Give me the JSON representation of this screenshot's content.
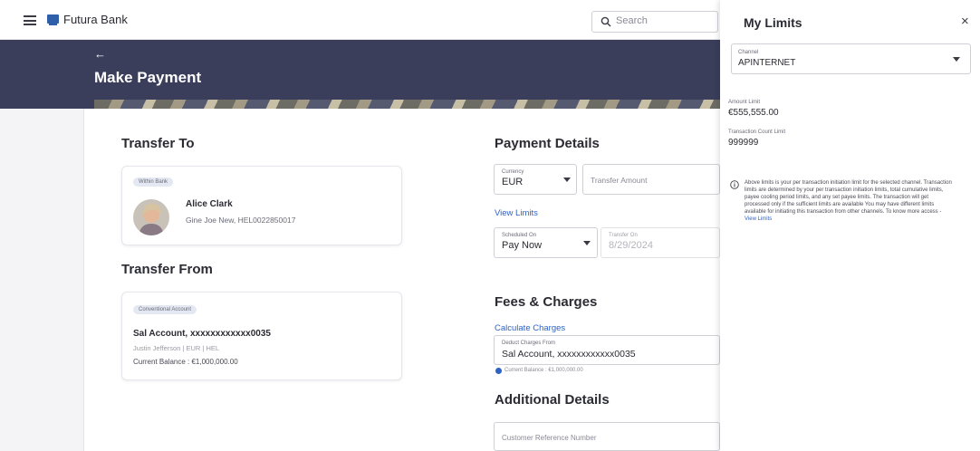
{
  "topbar": {
    "brand": "Futura Bank",
    "search_placeholder": "Search",
    "icons": [
      "hamburger-icon",
      "bank-logo-icon",
      "search-icon"
    ]
  },
  "page": {
    "back_symbol": "←",
    "title": "Make Payment"
  },
  "transfer_to": {
    "heading": "Transfer To",
    "badge": "Within Bank",
    "payee_name": "Alice Clark",
    "payee_details": "Gine Joe New, HEL0022850017"
  },
  "transfer_from": {
    "heading": "Transfer From",
    "badge": "Conventional Account",
    "account_name": "Sal Account, xxxxxxxxxxxx0035",
    "account_details": "Justin Jefferson | EUR | HEL",
    "balance": "Current Balance : €1,000,000.00"
  },
  "payment_details": {
    "heading": "Payment Details",
    "currency_label": "Currency",
    "currency_value": "EUR",
    "amount_placeholder": "Transfer Amount",
    "view_limits": "View Limits",
    "scheduled_label": "Scheduled On",
    "scheduled_value": "Pay Now",
    "transfer_on_label": "Transfer On",
    "transfer_on_value": "8/29/2024"
  },
  "fees": {
    "heading": "Fees & Charges",
    "calculate_link": "Calculate Charges",
    "deduct_label": "Deduct Charges From",
    "deduct_value": "Sal Account, xxxxxxxxxxxx0035",
    "current_balance": "Current Balance : €1,000,000.00"
  },
  "additional": {
    "heading": "Additional Details",
    "reference_placeholder": "Customer Reference Number"
  },
  "drawer": {
    "title": "My Limits",
    "close_symbol": "×",
    "channel_label": "Channel",
    "channel_value": "APINTERNET",
    "amount_limit_label": "Amount Limit",
    "amount_limit_value": "€555,555.00",
    "count_limit_label": "Transaction Count Limit",
    "count_limit_value": "999999",
    "note": "Above limits is your per transaction initiation limit for the selected channel. Transaction limits are determined by your per transaction initiation limits, total cumulative limits, payee cooling period limits, and any set payee limits. The transaction will get processed only if the sufficient limits are available You may have different limits available for initiating this transaction from other channels. To know more access -",
    "note_link": "View Limits"
  },
  "colors": {
    "header_band": "#3a3e5a",
    "link": "#2e62c4",
    "logo": "#2f5fa8"
  }
}
